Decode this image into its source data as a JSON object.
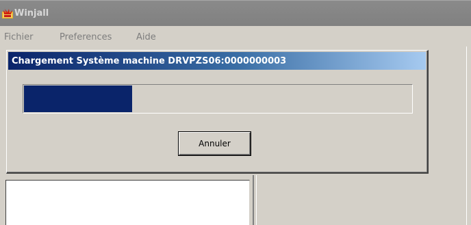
{
  "main_window": {
    "title": "Winjall",
    "icon": "winjall-app-icon"
  },
  "menu": {
    "items": [
      {
        "label": "Fichier"
      },
      {
        "label": "Preferences"
      },
      {
        "label": "Aide"
      }
    ]
  },
  "dialog": {
    "title": "Chargement Système machine DRVPZS06:0000000003",
    "progress_fraction": 0.28,
    "cancel_label": "Annuler"
  },
  "colors": {
    "title_active": "#0a246a",
    "title_gradient_end": "#a6caf0",
    "progress_fill": "#0a246a",
    "face": "#d4d0c8"
  }
}
